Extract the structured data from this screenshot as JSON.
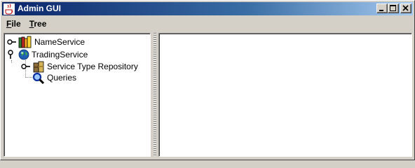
{
  "window": {
    "title": "Admin GUI",
    "controls": [
      "minimize",
      "maximize",
      "close"
    ]
  },
  "menubar": {
    "items": [
      {
        "label": "File",
        "mnemonic": "F"
      },
      {
        "label": "Tree",
        "mnemonic": "T"
      }
    ]
  },
  "tree": {
    "nodes": [
      {
        "label": "NameService",
        "icon": "books-icon",
        "expanded": false,
        "level": 0
      },
      {
        "label": "TradingService",
        "icon": "globe-icon",
        "expanded": true,
        "level": 0
      },
      {
        "label": "Service Type Repository",
        "icon": "boxes-icon",
        "expanded": false,
        "level": 1
      },
      {
        "label": "Queries",
        "icon": "magnifier-icon",
        "expanded": false,
        "level": 1
      }
    ]
  },
  "colors": {
    "titlebar_start": "#0a246a",
    "titlebar_end": "#a6caf0",
    "window_bg": "#d4d0c8",
    "pane_bg": "#ffffff"
  }
}
